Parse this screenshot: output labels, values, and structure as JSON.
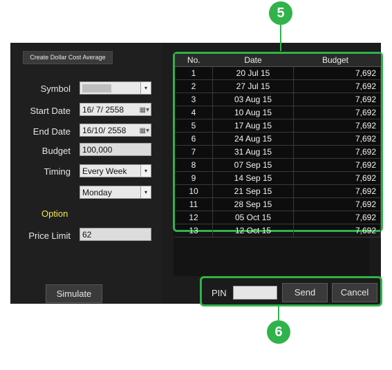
{
  "header": {
    "title": "Create Dollar Cost Average"
  },
  "form": {
    "symbol_label": "Symbol",
    "symbol_value": "",
    "start_label": "Start Date",
    "start_value": "16/ 7/ 2558",
    "end_label": "End Date",
    "end_value": "16/10/ 2558",
    "budget_label": "Budget",
    "budget_value": "100,000",
    "timing_label": "Timing",
    "timing_value": "Every Week",
    "day_value": "Monday",
    "option_label": "Option",
    "price_limit_label": "Price Limit",
    "price_limit_value": "62",
    "simulate_label": "Simulate"
  },
  "table": {
    "headers": [
      "No.",
      "Date",
      "Budget"
    ],
    "rows": [
      [
        "1",
        "20 Jul 15",
        "7,692"
      ],
      [
        "2",
        "27 Jul 15",
        "7,692"
      ],
      [
        "3",
        "03 Aug 15",
        "7,692"
      ],
      [
        "4",
        "10 Aug 15",
        "7,692"
      ],
      [
        "5",
        "17 Aug 15",
        "7,692"
      ],
      [
        "6",
        "24 Aug 15",
        "7,692"
      ],
      [
        "7",
        "31 Aug 15",
        "7,692"
      ],
      [
        "8",
        "07 Sep 15",
        "7,692"
      ],
      [
        "9",
        "14 Sep 15",
        "7,692"
      ],
      [
        "10",
        "21 Sep 15",
        "7,692"
      ],
      [
        "11",
        "28 Sep 15",
        "7,692"
      ],
      [
        "12",
        "05 Oct 15",
        "7,692"
      ],
      [
        "13",
        "12 Oct 15",
        "7,692"
      ]
    ]
  },
  "pin": {
    "label": "PIN",
    "value": "",
    "send_label": "Send",
    "cancel_label": "Cancel"
  },
  "callouts": {
    "top": "5",
    "bottom": "6"
  },
  "colors": {
    "highlight": "#2fb34a",
    "option": "#f6e84a",
    "panel": "#1c1c1c"
  },
  "icons": [
    "dropdown-arrow-icon",
    "calendar-icon"
  ]
}
